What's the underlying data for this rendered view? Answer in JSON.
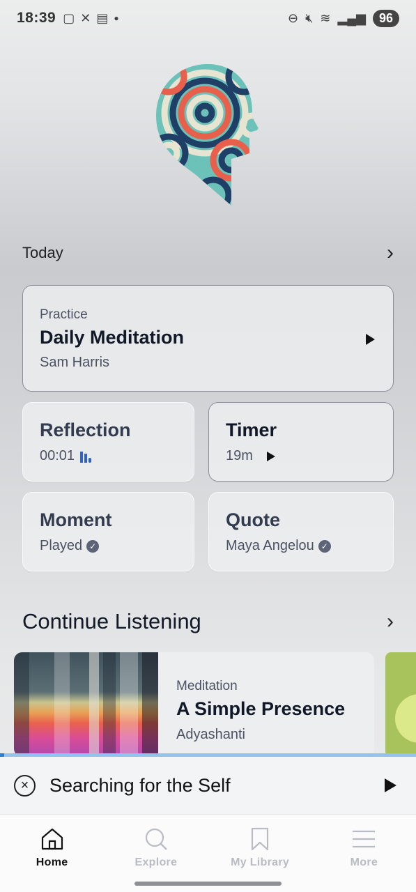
{
  "status_bar": {
    "time": "18:39",
    "battery": "96",
    "left_icons": [
      "screenshot-icon",
      "missed-call-icon",
      "calendar-icon",
      "dot-icon"
    ],
    "right_icons": [
      "do-not-disturb-icon",
      "mute-icon",
      "wifi-icon",
      "signal-icon"
    ]
  },
  "today": {
    "heading": "Today"
  },
  "cards": {
    "practice": {
      "kicker": "Practice",
      "title": "Daily Meditation",
      "subtitle": "Sam Harris"
    },
    "reflection": {
      "title": "Reflection",
      "subtitle": "00:01"
    },
    "timer": {
      "title": "Timer",
      "subtitle": "19m"
    },
    "moment": {
      "title": "Moment",
      "subtitle": "Played"
    },
    "quote": {
      "title": "Quote",
      "subtitle": "Maya Angelou"
    }
  },
  "continue_listening": {
    "heading": "Continue Listening",
    "items": [
      {
        "kicker": "Meditation",
        "title": "A Simple Presence",
        "author": "Adyashanti"
      }
    ]
  },
  "mini_player": {
    "title": "Searching for the Self",
    "progress": 0.01
  },
  "nav": {
    "items": [
      {
        "label": "Home",
        "icon": "home-icon",
        "active": true
      },
      {
        "label": "Explore",
        "icon": "search-icon",
        "active": false
      },
      {
        "label": "My Library",
        "icon": "bookmark-icon",
        "active": false
      },
      {
        "label": "More",
        "icon": "menu-icon",
        "active": false
      }
    ]
  },
  "colors": {
    "accent_blue": "#2a7fd4",
    "text_dark": "#111827",
    "text_muted": "#4b5263",
    "logo_teal": "#6cc2b8",
    "logo_coral": "#e8604c",
    "logo_navy": "#1f3f66"
  }
}
